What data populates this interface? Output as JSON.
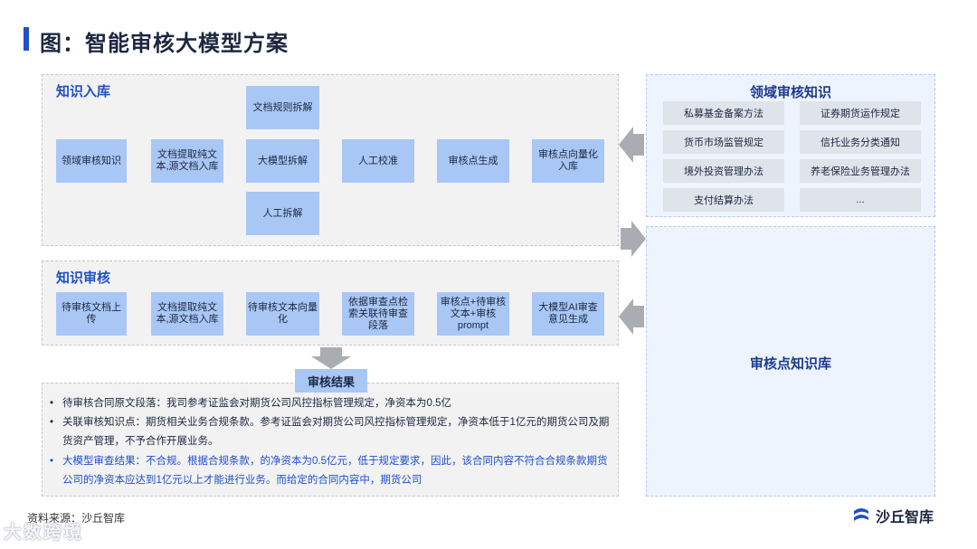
{
  "header": {
    "title": "图：智能审核大模型方案"
  },
  "knowledge_ingest": {
    "label": "知识入库",
    "nodes": {
      "domain_knowledge": "领域审核知识",
      "extract_text": "文档提取纯文本,源文档入库",
      "rule_split": "文档规则拆解",
      "llm_split": "大模型拆解",
      "manual_split": "人工拆解",
      "manual_check": "人工校准",
      "point_gen": "审核点生成",
      "point_vector": "审核点向量化入库"
    }
  },
  "knowledge_review": {
    "label": "知识审核",
    "nodes": {
      "upload": "待审核文档上传",
      "extract_text": "文档提取纯文本,源文档入库",
      "vectorize": "待审核文本向量化",
      "retrieve": "依据审查点检索关联待审查段落",
      "prompt": "审核点+待审核文本+审核prompt",
      "ai_review": "大模型AI审查意见生成"
    }
  },
  "domain_kb": {
    "label": "领域审核知识",
    "items": [
      "私募基金备案方法",
      "证券期货运作规定",
      "货币市场监管规定",
      "信托业务分类通知",
      "境外投资管理办法",
      "养老保险业务管理办法",
      "支付结算办法",
      "..."
    ]
  },
  "point_kb": {
    "label": "审核点知识库"
  },
  "results": {
    "label": "审核结果",
    "items": [
      {
        "text": "待审核合同原文段落：我司参考证监会对期货公司风控指标管理规定，净资本为0.5亿",
        "highlight": false
      },
      {
        "text": "关联审核知识点：期货相关业务合规条款。参考证监会对期货公司风控指标管理规定，净资本低于1亿元的期货公司及期货资产管理，不予合作开展业务。",
        "highlight": false
      },
      {
        "text": "大模型审查结果：不合规。根据合规条款，的净资本为0.5亿元，低于规定要求，因此，该合同内容不符合合规条款期货公司的净资本应达到1亿元以上才能进行业务。而给定的合同内容中，期货公司",
        "highlight": true
      }
    ]
  },
  "footer": {
    "source": "资料来源：沙丘智库",
    "brand": "沙丘智库",
    "watermark": "大数跨境"
  },
  "colors": {
    "accent": "#1f4fc9",
    "node": "#a9c7f5",
    "panel": "#f2f2f3",
    "kb_panel": "#eef4fd"
  }
}
